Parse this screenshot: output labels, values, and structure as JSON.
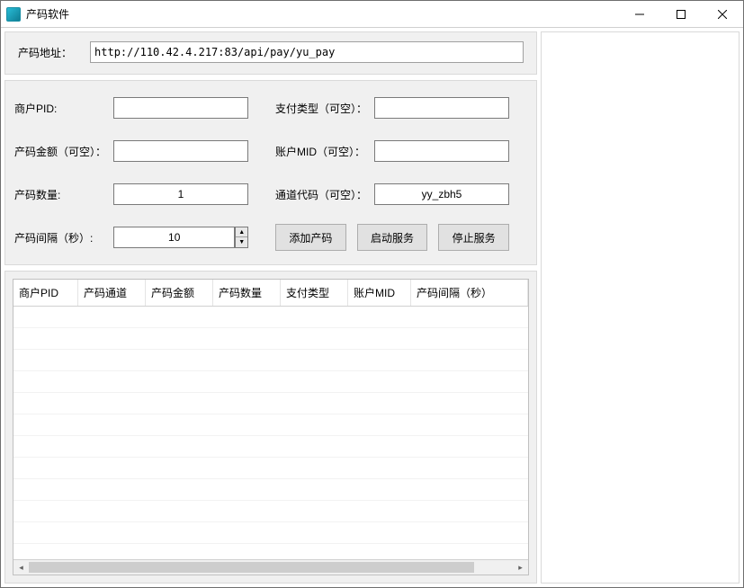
{
  "window": {
    "title": "产码软件"
  },
  "address": {
    "label": "产码地址：",
    "value": "http://110.42.4.217:83/api/pay/yu_pay"
  },
  "form": {
    "merchant_pid_label": "商户PID:",
    "merchant_pid_value": "",
    "pay_type_label": "支付类型（可空）：",
    "pay_type_value": "",
    "amount_label": "产码金额（可空）：",
    "amount_value": "",
    "account_mid_label": "账户MID（可空）：",
    "account_mid_value": "",
    "quantity_label": "产码数量:",
    "quantity_value": "1",
    "channel_code_label": "通道代码（可空）：",
    "channel_code_value": "yy_zbh5",
    "interval_label": "产码间隔（秒）:",
    "interval_value": "10"
  },
  "buttons": {
    "add": "添加产码",
    "start": "启动服务",
    "stop": "停止服务"
  },
  "table": {
    "columns": [
      "商户PID",
      "产码通道",
      "产码金额",
      "产码数量",
      "支付类型",
      "账户MID",
      "产码间隔（秒）"
    ],
    "rows": []
  }
}
